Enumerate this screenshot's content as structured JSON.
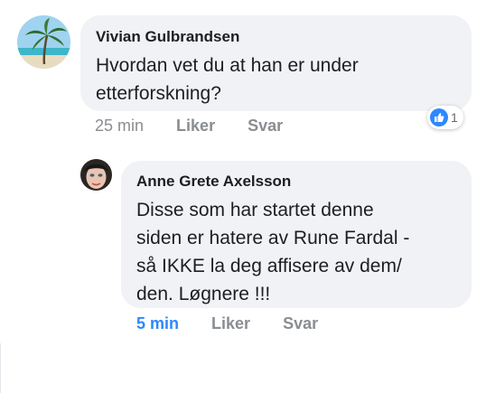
{
  "comments": [
    {
      "author": "Vivian Gulbrandsen",
      "text_lines": [
        "Hvordan vet du at han er under",
        "etterforskning?"
      ],
      "time": "25 min",
      "like_label": "Liker",
      "reply_label": "Svar",
      "reaction": {
        "icon": "thumbs-up-icon",
        "count": "1",
        "color": "#2d88ff"
      }
    },
    {
      "author": "Anne Grete Axelsson",
      "text_lines": [
        "Disse som har startet denne",
        "siden er hatere av Rune Fardal -",
        "så IKKE la deg affisere av dem/",
        "den. Løgnere !!!"
      ],
      "time": "5 min",
      "like_label": "Liker",
      "reply_label": "Svar",
      "time_color": "#2d88ff"
    }
  ]
}
